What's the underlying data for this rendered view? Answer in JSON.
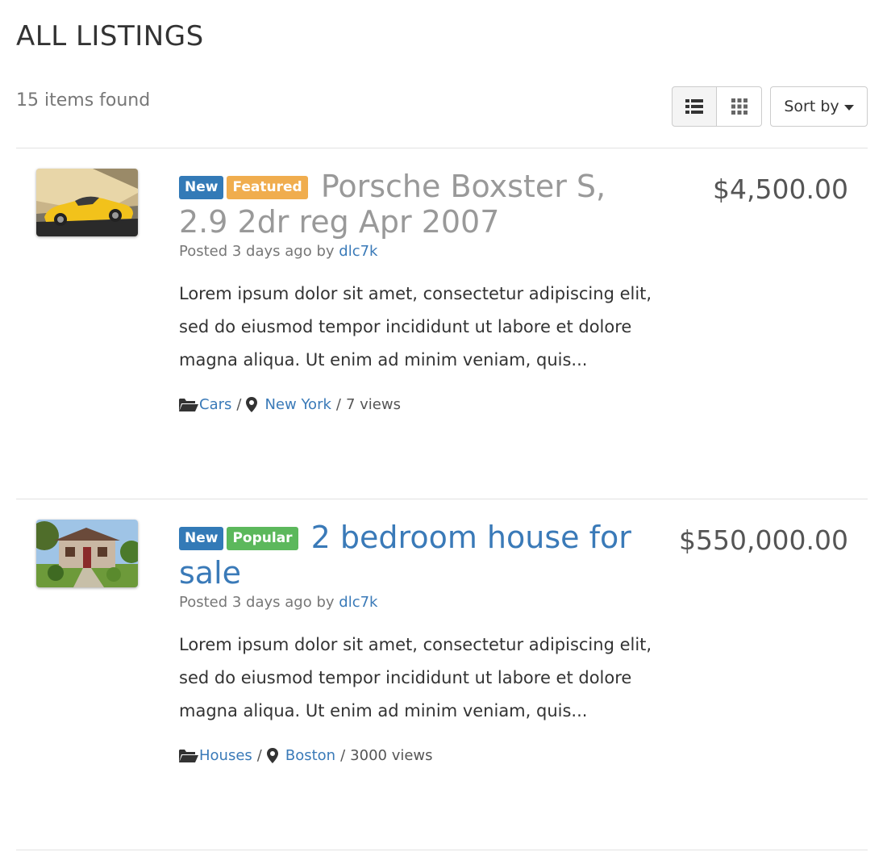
{
  "header": {
    "title": "ALL LISTINGS",
    "count_text": "15 items found",
    "sort_label": "Sort by"
  },
  "icons": {
    "list_view": "list-icon",
    "grid_view": "grid-icon",
    "caret": "caret-down-icon",
    "folder": "folder-open-icon",
    "location": "map-marker-icon"
  },
  "colors": {
    "link": "#3a7ab8",
    "badge_new": "#337ab7",
    "badge_featured": "#f0ad4e",
    "badge_popular": "#5cb85c"
  },
  "listings": [
    {
      "badges": [
        "New",
        "Featured"
      ],
      "title": "Porsche Boxster S, 2.9 2dr reg Apr 2007",
      "posted_prefix": "Posted 3 days ago by",
      "author": "dlc7k",
      "price": "$4,500.00",
      "description": "Lorem ipsum dolor sit amet, consectetur adipiscing elit, sed do eiusmod tempor incididunt ut labore et dolore magna aliqua. Ut enim ad minim veniam, quis...",
      "category": "Cars",
      "location": "New York",
      "views": "7 views",
      "image": "yellow-sports-car-photo"
    },
    {
      "badges": [
        "New",
        "Popular"
      ],
      "title": "2 bedroom house for sale",
      "posted_prefix": "Posted 3 days ago by",
      "author": "dlc7k",
      "price": "$550,000.00",
      "description": "Lorem ipsum dolor sit amet, consectetur adipiscing elit, sed do eiusmod tempor incididunt ut labore et dolore magna aliqua. Ut enim ad minim veniam, quis...",
      "category": "Houses",
      "location": "Boston",
      "views": "3000 views",
      "image": "house-photo"
    }
  ]
}
